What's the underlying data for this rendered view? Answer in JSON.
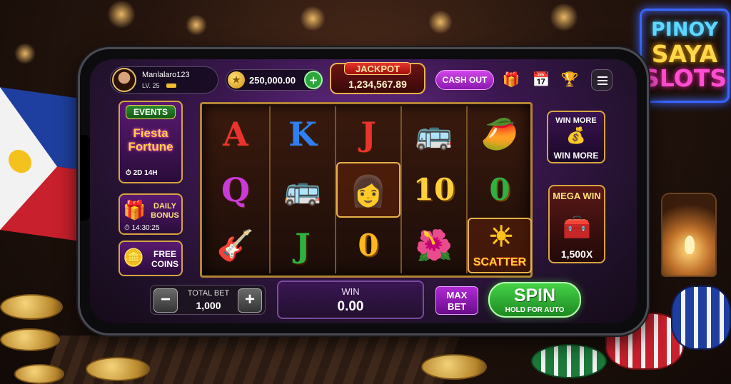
{
  "background": {
    "neon_sign": [
      "PINOY",
      "SAYA",
      "SLOTS"
    ]
  },
  "player": {
    "username": "Manlalaro123",
    "level": "LV. 25"
  },
  "balance": {
    "coins": "250,000.00",
    "add_label": "+"
  },
  "jackpot": {
    "label": "JACKPOT",
    "value": "1,234,567.89"
  },
  "toolbar": {
    "cashout_label": "CASH OUT",
    "icons": [
      "gift-icon",
      "calendar-icon",
      "trophy-icon",
      "menu-icon"
    ]
  },
  "left_panel": {
    "events_label": "EVENTS",
    "event_title": "Fiesta Fortune",
    "event_timer": "2D 14H",
    "daily_bonus_label": "DAILY BONUS",
    "daily_bonus_timer": "14:30:25",
    "free_coins_label": "FREE COINS"
  },
  "right_panel": {
    "win_more_top": "WIN MORE",
    "win_more_bottom": "WIN MORE",
    "mega_win_label": "MEGA WIN",
    "mega_win_multiplier": "1,500X"
  },
  "reels": [
    [
      {
        "label": "A",
        "color": "#e8342c"
      },
      {
        "label": "Q",
        "color": "#c93ad8"
      },
      {
        "label": "guitar-icon",
        "glyph": "🎸"
      }
    ],
    [
      {
        "label": "K",
        "color": "#2f7ff0"
      },
      {
        "label": "jeepney-icon",
        "glyph": "🚌"
      },
      {
        "label": "J",
        "color": "#2fb040"
      }
    ],
    [
      {
        "label": "J",
        "color": "#e8342c"
      },
      {
        "label": "filipina-woman-icon",
        "glyph": "👩"
      },
      {
        "label": "0",
        "color": "#ffb81c"
      }
    ],
    [
      {
        "label": "jeepney-icon",
        "glyph": "🚌"
      },
      {
        "label": "10",
        "color": "#ffcf3a"
      },
      {
        "label": "flowers-icon",
        "glyph": "🌺"
      }
    ],
    [
      {
        "label": "mango-icon",
        "glyph": "🥭"
      },
      {
        "label": "0",
        "color": "#2fb040"
      },
      {
        "label": "SCATTER",
        "color": "#ffd23a"
      }
    ]
  ],
  "controls": {
    "minus_label": "−",
    "plus_label": "+",
    "total_bet_label": "TOTAL BET",
    "total_bet_value": "1,000",
    "win_label": "WIN",
    "win_value": "0.00",
    "max_bet_label": "MAX BET",
    "spin_label": "SPIN",
    "spin_hint": "HOLD FOR AUTO"
  }
}
